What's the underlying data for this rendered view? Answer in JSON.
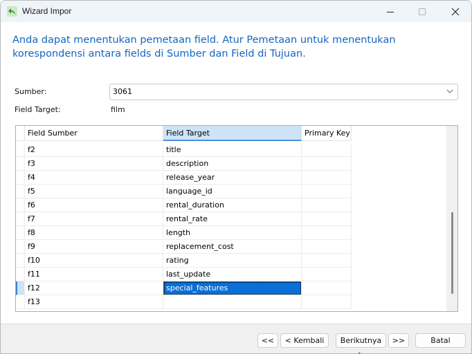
{
  "window": {
    "title": "Wizard Impor",
    "controls": {
      "minimize": "minimize",
      "maximize": "maximize",
      "close": "close"
    }
  },
  "intro_text": "Anda dapat menentukan pemetaan field. Atur Pemetaan untuk menentukan korespondensi antara fields di Sumber dan Field di Tujuan.",
  "form": {
    "source_label": "Sumber:",
    "source_value": "3061",
    "target_label": "Field Target:",
    "target_value": "film"
  },
  "grid": {
    "columns": [
      "Field Sumber",
      "Field Target",
      "Primary Key"
    ],
    "active_column": 1,
    "rows": [
      {
        "source": "f2",
        "target": "title",
        "pk": ""
      },
      {
        "source": "f3",
        "target": "description",
        "pk": ""
      },
      {
        "source": "f4",
        "target": "release_year",
        "pk": ""
      },
      {
        "source": "f5",
        "target": "language_id",
        "pk": ""
      },
      {
        "source": "f6",
        "target": "rental_duration",
        "pk": ""
      },
      {
        "source": "f7",
        "target": "rental_rate",
        "pk": ""
      },
      {
        "source": "f8",
        "target": "length",
        "pk": ""
      },
      {
        "source": "f9",
        "target": "replacement_cost",
        "pk": ""
      },
      {
        "source": "f10",
        "target": "rating",
        "pk": ""
      },
      {
        "source": "f11",
        "target": "last_update",
        "pk": ""
      },
      {
        "source": "f12",
        "target": "special_features",
        "pk": ""
      },
      {
        "source": "f13",
        "target": "",
        "pk": ""
      }
    ],
    "selected_row": 10,
    "selected_column": 1
  },
  "buttons": {
    "first": "<<",
    "back": "< Kembali",
    "next": "Berikutnya >",
    "last": ">>",
    "cancel": "Batal"
  },
  "colors": {
    "intro_text": "#1565c0",
    "selection": "#0a6fd6",
    "header_active": "#cde4f7"
  }
}
